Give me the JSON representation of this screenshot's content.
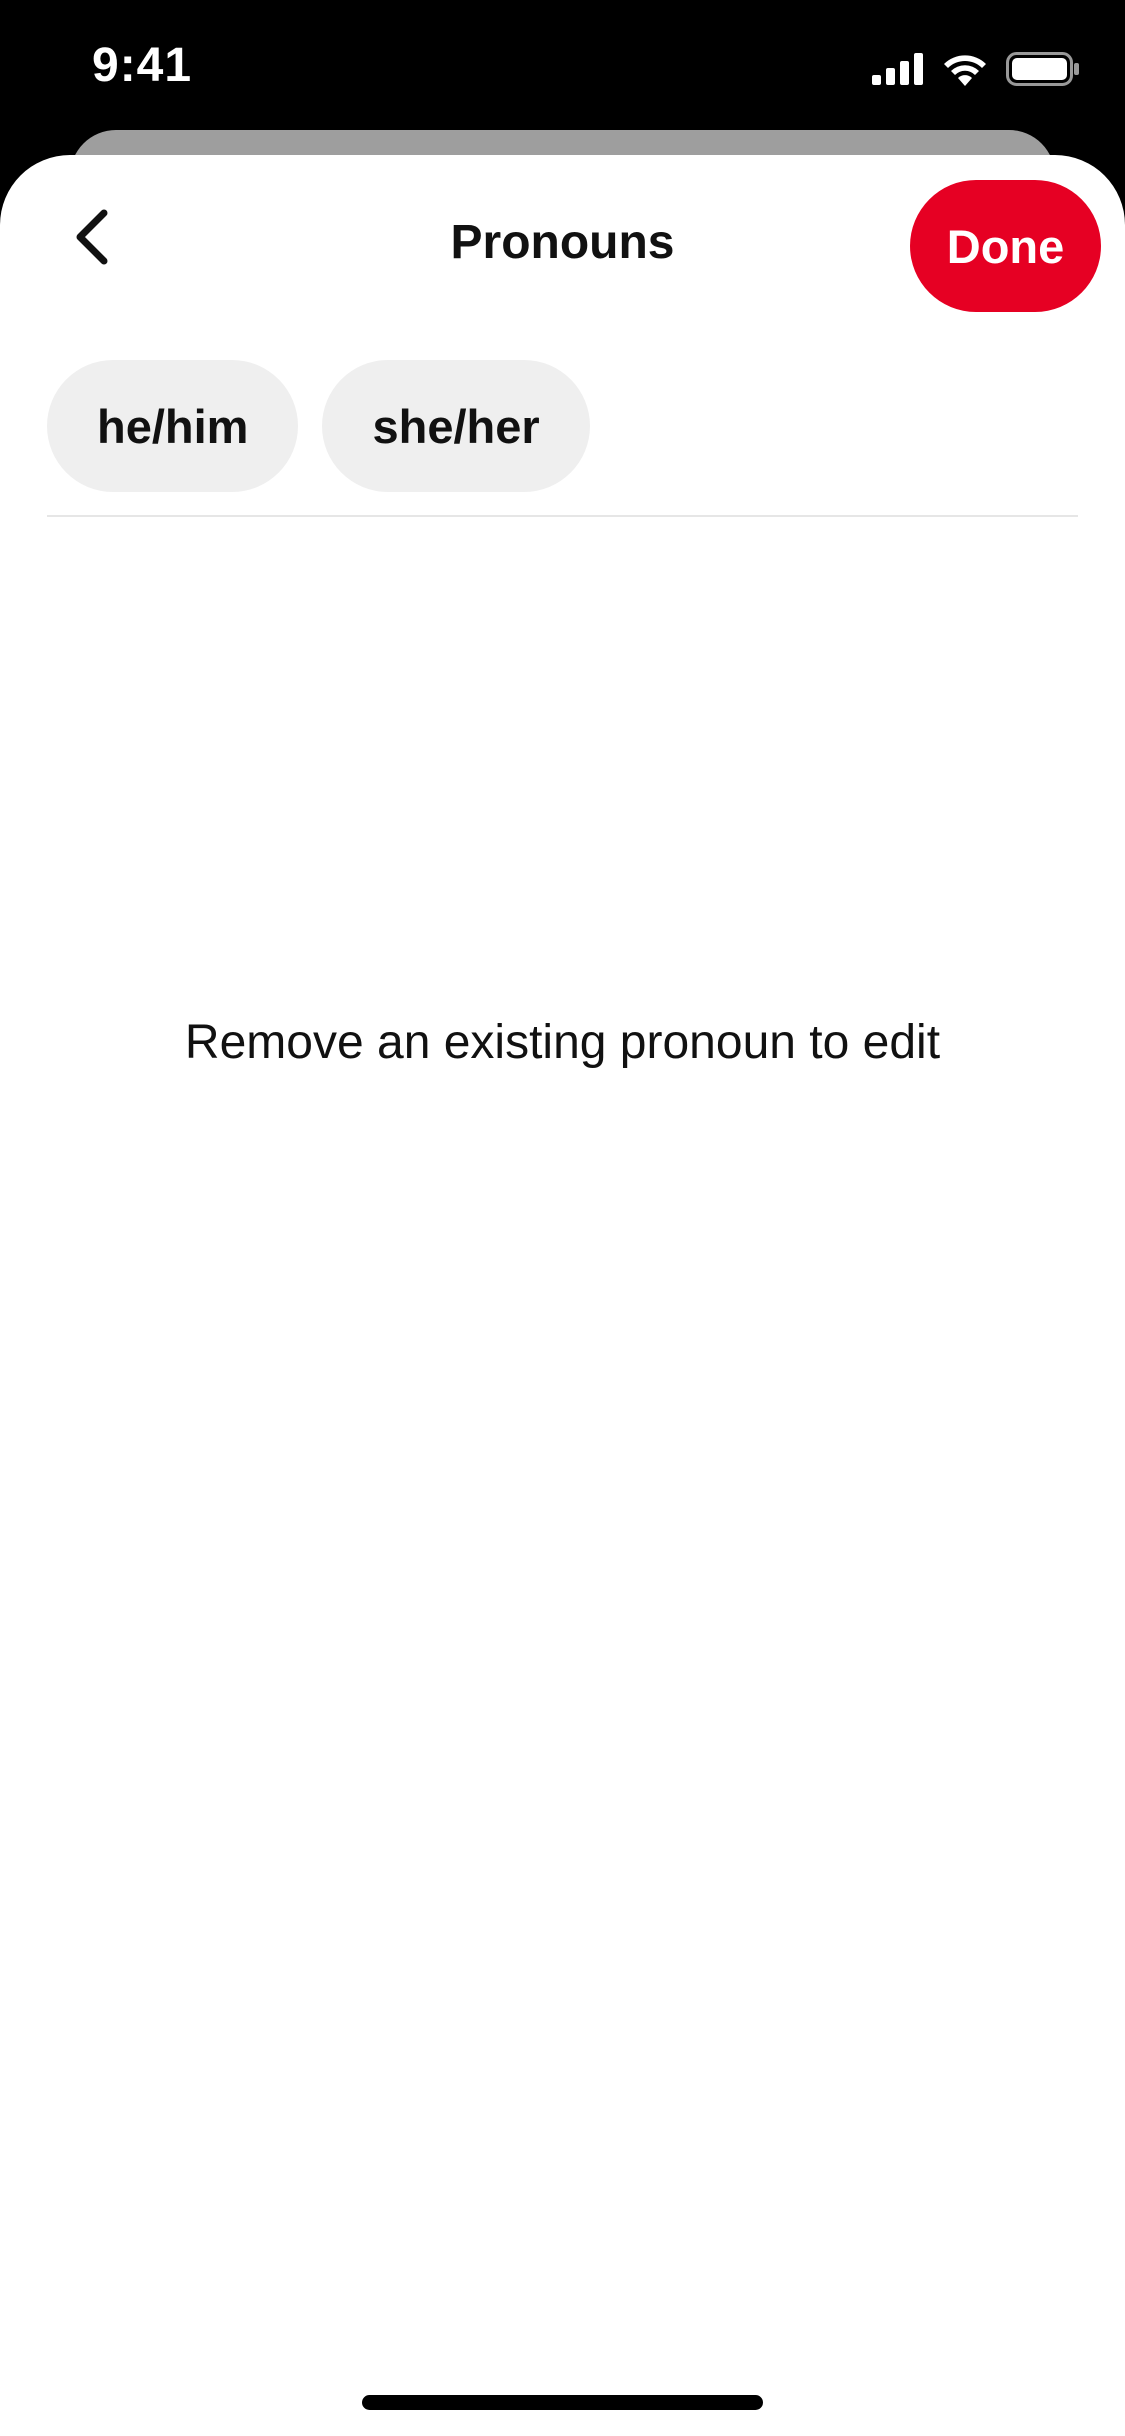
{
  "status_bar": {
    "time": "9:41",
    "icons": [
      "signal-icon",
      "wifi-icon",
      "battery-icon"
    ]
  },
  "header": {
    "title": "Pronouns",
    "back_icon": "chevron-left-icon",
    "done_label": "Done"
  },
  "pronouns": [
    {
      "label": "he/him"
    },
    {
      "label": "she/her"
    }
  ],
  "hint": "Remove an existing pronoun to edit",
  "colors": {
    "accent": "#e60023",
    "chip_bg": "#efefef",
    "text": "#111111"
  }
}
